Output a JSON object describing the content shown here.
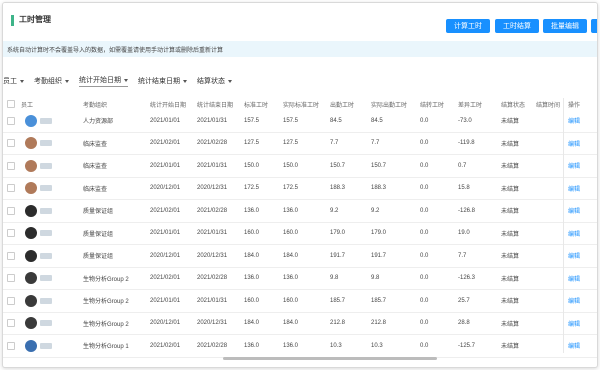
{
  "header": {
    "title": "工时管理",
    "buttons": [
      {
        "label": "计算工时"
      },
      {
        "label": "工时结算"
      },
      {
        "label": "批量编辑"
      }
    ]
  },
  "notice": "系统自动计算时不会覆盖导入的数据，如需覆盖请使用手动计算或删除后重新计算",
  "filters": [
    {
      "label": "员工"
    },
    {
      "label": "考勤组织"
    },
    {
      "label": "统计开始日期"
    },
    {
      "label": "统计结束日期"
    },
    {
      "label": "结算状态"
    }
  ],
  "table": {
    "columns": [
      "员工",
      "考勤组织",
      "统计开始日期",
      "统计结束日期",
      "标准工时",
      "实际标准工时",
      "出勤工时",
      "实际出勤工时",
      "结转工时",
      "差异工时",
      "结算状态",
      "结算时间",
      "操作"
    ],
    "rows": [
      {
        "avatar": "#4a90d9",
        "org": "人力资源部",
        "start": "2021/01/01",
        "end": "2021/01/31",
        "std": "157.5",
        "actual_std": "157.5",
        "attend": "84.5",
        "actual_attend": "84.5",
        "carry": "0.0",
        "diff": "-73.0",
        "status": "未结算",
        "time": "",
        "op": "编辑"
      },
      {
        "avatar": "#b07a5a",
        "org": "临床监查",
        "start": "2021/02/01",
        "end": "2021/02/28",
        "std": "127.5",
        "actual_std": "127.5",
        "attend": "7.7",
        "actual_attend": "7.7",
        "carry": "0.0",
        "diff": "-119.8",
        "status": "未结算",
        "time": "",
        "op": "编辑"
      },
      {
        "avatar": "#b07a5a",
        "org": "临床监查",
        "start": "2021/01/01",
        "end": "2021/01/31",
        "std": "150.0",
        "actual_std": "150.0",
        "attend": "150.7",
        "actual_attend": "150.7",
        "carry": "0.0",
        "diff": "0.7",
        "status": "未结算",
        "time": "",
        "op": "编辑"
      },
      {
        "avatar": "#b07a5a",
        "org": "临床监查",
        "start": "2020/12/01",
        "end": "2020/12/31",
        "std": "172.5",
        "actual_std": "172.5",
        "attend": "188.3",
        "actual_attend": "188.3",
        "carry": "0.0",
        "diff": "15.8",
        "status": "未结算",
        "time": "",
        "op": "编辑"
      },
      {
        "avatar": "#2c2c2c",
        "org": "质量保证组",
        "start": "2021/02/01",
        "end": "2021/02/28",
        "std": "136.0",
        "actual_std": "136.0",
        "attend": "9.2",
        "actual_attend": "9.2",
        "carry": "0.0",
        "diff": "-126.8",
        "status": "未结算",
        "time": "",
        "op": "编辑"
      },
      {
        "avatar": "#2c2c2c",
        "org": "质量保证组",
        "start": "2021/01/01",
        "end": "2021/01/31",
        "std": "160.0",
        "actual_std": "160.0",
        "attend": "179.0",
        "actual_attend": "179.0",
        "carry": "0.0",
        "diff": "19.0",
        "status": "未结算",
        "time": "",
        "op": "编辑"
      },
      {
        "avatar": "#2c2c2c",
        "org": "质量保证组",
        "start": "2020/12/01",
        "end": "2020/12/31",
        "std": "184.0",
        "actual_std": "184.0",
        "attend": "191.7",
        "actual_attend": "191.7",
        "carry": "0.0",
        "diff": "7.7",
        "status": "未结算",
        "time": "",
        "op": "编辑"
      },
      {
        "avatar": "#3a3a3a",
        "org": "生物分析Group 2",
        "start": "2021/02/01",
        "end": "2021/02/28",
        "std": "136.0",
        "actual_std": "136.0",
        "attend": "9.8",
        "actual_attend": "9.8",
        "carry": "0.0",
        "diff": "-126.3",
        "status": "未结算",
        "time": "",
        "op": "编辑"
      },
      {
        "avatar": "#3a3a3a",
        "org": "生物分析Group 2",
        "start": "2021/01/01",
        "end": "2021/01/31",
        "std": "160.0",
        "actual_std": "160.0",
        "attend": "185.7",
        "actual_attend": "185.7",
        "carry": "0.0",
        "diff": "25.7",
        "status": "未结算",
        "time": "",
        "op": "编辑"
      },
      {
        "avatar": "#3a3a3a",
        "org": "生物分析Group 2",
        "start": "2020/12/01",
        "end": "2020/12/31",
        "std": "184.0",
        "actual_std": "184.0",
        "attend": "212.8",
        "actual_attend": "212.8",
        "carry": "0.0",
        "diff": "28.8",
        "status": "未结算",
        "time": "",
        "op": "编辑"
      },
      {
        "avatar": "#3a6fb0",
        "org": "生物分析Group 1",
        "start": "2021/02/01",
        "end": "2021/02/28",
        "std": "136.0",
        "actual_std": "136.0",
        "attend": "10.3",
        "actual_attend": "10.3",
        "carry": "0.0",
        "diff": "-125.7",
        "status": "未结算",
        "time": "",
        "op": "编辑"
      }
    ]
  },
  "colors": {
    "accent": "#1890ff",
    "title_bar": "#3eb489",
    "notice_bg": "#eaf6fc"
  }
}
